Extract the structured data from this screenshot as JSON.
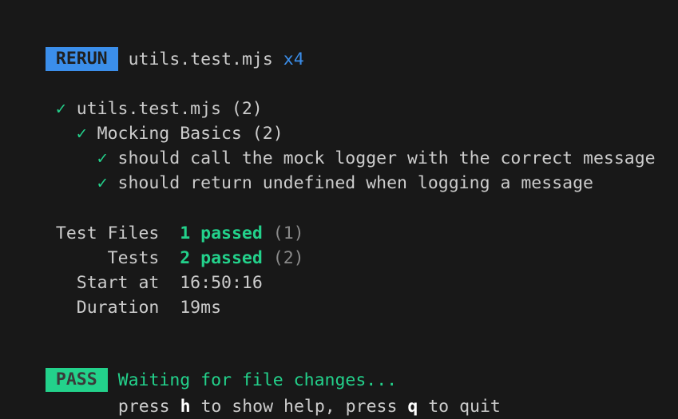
{
  "header": {
    "badge": "RERUN",
    "file": "utils.test.mjs",
    "count": "x4"
  },
  "tree": [
    {
      "icon": "check-icon",
      "glyph": "✓",
      "label": "utils.test.mjs (2)",
      "indent": 1
    },
    {
      "icon": "check-icon",
      "glyph": "✓",
      "label": "Mocking Basics (2)",
      "indent": 3
    },
    {
      "icon": "check-icon",
      "glyph": "✓",
      "label": "should call the mock logger with the correct message",
      "indent": 5
    },
    {
      "icon": "check-icon",
      "glyph": "✓",
      "label": "should return undefined when logging a message",
      "indent": 5
    }
  ],
  "summary": {
    "test_files": {
      "label": "Test Files",
      "passed": "1 passed",
      "total": "(1)"
    },
    "tests": {
      "label": "Tests",
      "passed": "2 passed",
      "total": "(2)"
    },
    "start_at": {
      "label": "Start at",
      "value": "16:50:16"
    },
    "duration": {
      "label": "Duration",
      "value": "19ms"
    }
  },
  "footer": {
    "badge": "PASS",
    "status": "Waiting for file changes...",
    "help_prefix": "press ",
    "help_key": "h",
    "help_middle": " to show help, press ",
    "quit_key": "q",
    "help_suffix": " to quit"
  },
  "colors": {
    "background": "#181818",
    "rerun_badge": "#3b8eea",
    "pass_green": "#23d18b",
    "text": "#cccccc",
    "dim": "#8a8a8a"
  }
}
